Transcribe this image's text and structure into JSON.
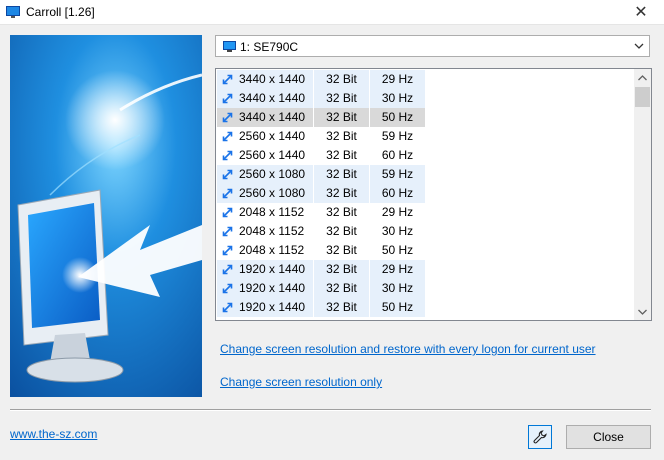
{
  "window": {
    "title": "Carroll [1.26]"
  },
  "monitor_select": {
    "value": "1: SE790C"
  },
  "modes": [
    {
      "res": "3440 x 1440",
      "bits": "32 Bit",
      "hz": "29 Hz",
      "state": "blue"
    },
    {
      "res": "3440 x 1440",
      "bits": "32 Bit",
      "hz": "30 Hz",
      "state": "blue"
    },
    {
      "res": "3440 x 1440",
      "bits": "32 Bit",
      "hz": "50 Hz",
      "state": "selected"
    },
    {
      "res": "2560 x 1440",
      "bits": "32 Bit",
      "hz": "59 Hz",
      "state": "white"
    },
    {
      "res": "2560 x 1440",
      "bits": "32 Bit",
      "hz": "60 Hz",
      "state": "white"
    },
    {
      "res": "2560 x 1080",
      "bits": "32 Bit",
      "hz": "59 Hz",
      "state": "blue"
    },
    {
      "res": "2560 x 1080",
      "bits": "32 Bit",
      "hz": "60 Hz",
      "state": "blue"
    },
    {
      "res": "2048 x 1152",
      "bits": "32 Bit",
      "hz": "29 Hz",
      "state": "white"
    },
    {
      "res": "2048 x 1152",
      "bits": "32 Bit",
      "hz": "30 Hz",
      "state": "white"
    },
    {
      "res": "2048 x 1152",
      "bits": "32 Bit",
      "hz": "50 Hz",
      "state": "white"
    },
    {
      "res": "1920 x 1440",
      "bits": "32 Bit",
      "hz": "29 Hz",
      "state": "blue"
    },
    {
      "res": "1920 x 1440",
      "bits": "32 Bit",
      "hz": "30 Hz",
      "state": "blue"
    },
    {
      "res": "1920 x 1440",
      "bits": "32 Bit",
      "hz": "50 Hz",
      "state": "blue"
    }
  ],
  "links": {
    "restore": "Change screen resolution and restore with every logon for current user",
    "only": "Change screen resolution only",
    "website": "www.the-sz.com"
  },
  "buttons": {
    "close": "Close",
    "tools_icon": "wrench-icon"
  },
  "icons": {
    "resolution": "resize-arrow-icon",
    "monitor": "monitor-icon"
  },
  "colors": {
    "link": "#0066cc",
    "row_alt": "#e6f0fb",
    "row_selected": "#d9d9d9",
    "banner": "#1577c9"
  }
}
